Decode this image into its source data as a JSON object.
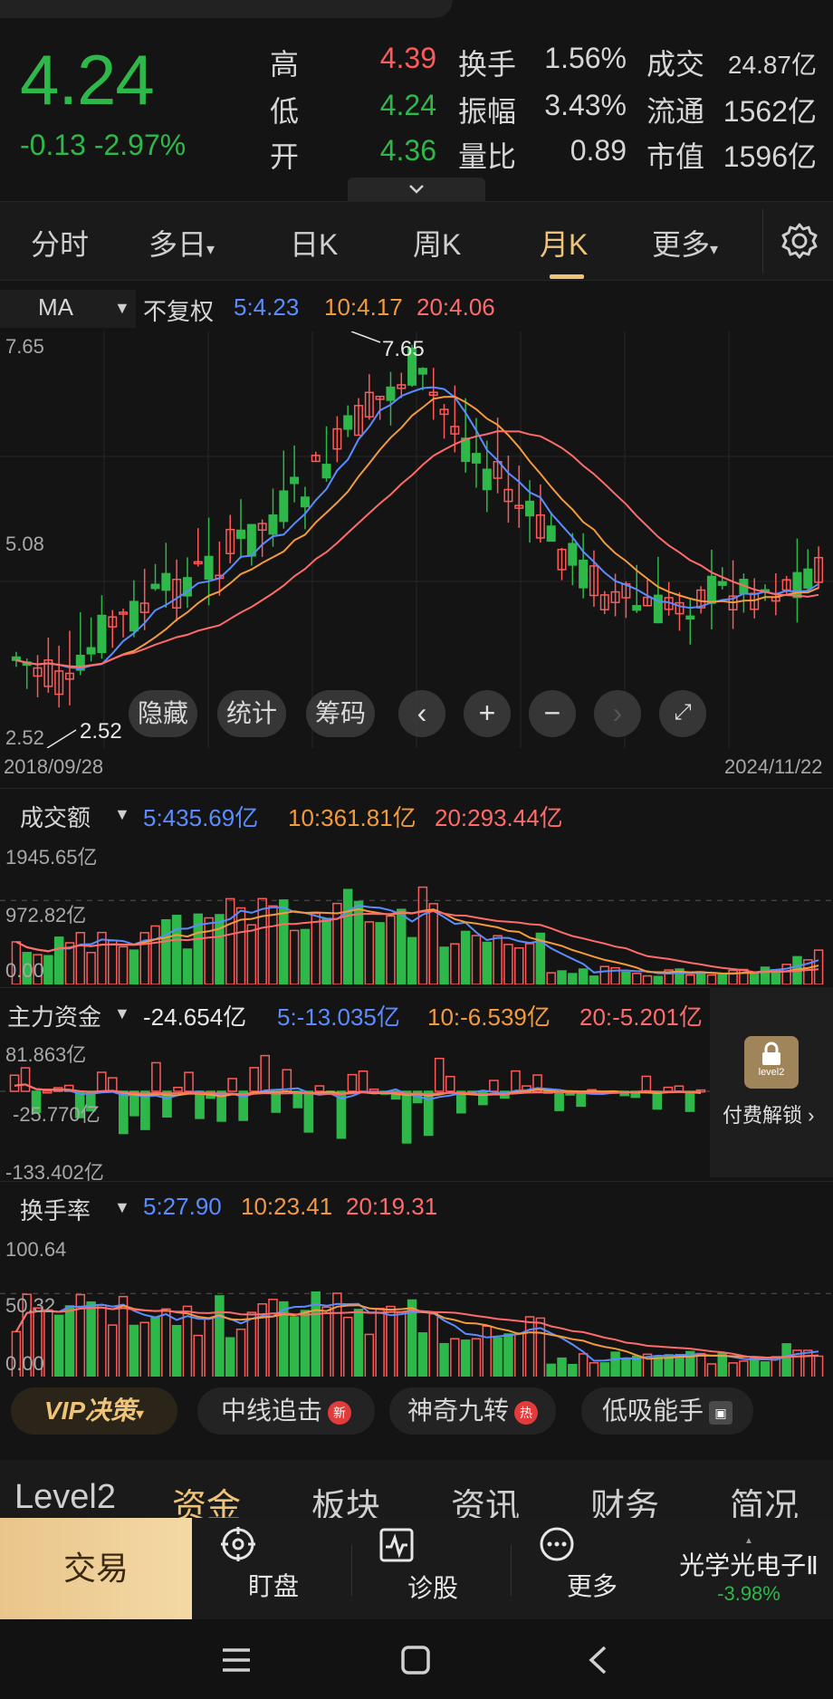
{
  "quote": {
    "price": "4.24",
    "change": "-0.13 -2.97%",
    "stats": [
      {
        "label": "高",
        "value": "4.39",
        "color": "red"
      },
      {
        "label": "换手",
        "value": "1.56%",
        "color": "white"
      },
      {
        "label": "成交",
        "value": "24.87亿",
        "color": "white"
      },
      {
        "label": "低",
        "value": "4.24",
        "color": "green"
      },
      {
        "label": "振幅",
        "value": "3.43%",
        "color": "white"
      },
      {
        "label": "流通",
        "value": "1562亿",
        "color": "white"
      },
      {
        "label": "开",
        "value": "4.36",
        "color": "green"
      },
      {
        "label": "量比",
        "value": "0.89",
        "color": "white"
      },
      {
        "label": "市值",
        "value": "1596亿",
        "color": "white"
      }
    ],
    "expand_icon": "chevron-down-icon"
  },
  "tabs": [
    {
      "label": "分时"
    },
    {
      "label": "多日"
    },
    {
      "label": "日K"
    },
    {
      "label": "周K"
    },
    {
      "label": "月K",
      "active": true
    },
    {
      "label": "更多"
    }
  ],
  "settings_icon": "gear-icon",
  "kline": {
    "indicator": "MA",
    "adjust": "不复权",
    "ma5": "5:4.23",
    "ma10": "10:4.17",
    "ma20": "20:4.06",
    "y_top": "7.65",
    "y_mid": "5.08",
    "y_bottom": "2.52",
    "high_marker": "7.65",
    "low_marker": "2.52",
    "date_start": "2018/09/28",
    "date_end": "2024/11/22",
    "tools": [
      "隐藏",
      "统计",
      "筹码"
    ]
  },
  "volume": {
    "title": "成交额",
    "ma5": "5:435.69亿",
    "ma10": "10:361.81亿",
    "ma20": "20:293.44亿",
    "y_top": "1945.65亿",
    "y_mid": "972.82亿",
    "y_bottom": "0.00"
  },
  "capital": {
    "title": "主力资金",
    "value": "-24.654亿",
    "ma5": "5:-13.035亿",
    "ma10": "10:-6.539亿",
    "ma20": "20:-5.201亿",
    "y_top": "81.863亿",
    "y_mid": "-25.770亿",
    "y_bottom": "-133.402亿",
    "lock_label": "level2",
    "unlock_text": "付费解锁 ›"
  },
  "turnover": {
    "title": "换手率",
    "ma5": "5:27.90",
    "ma10": "10:23.41",
    "ma20": "20:19.31",
    "y_top": "100.64",
    "y_mid": "50.32",
    "y_bottom": "0.00"
  },
  "chips": {
    "vip": "VIP决策",
    "items": [
      {
        "label": "中线追击",
        "badge": "新"
      },
      {
        "label": "神奇九转",
        "badge": "热"
      },
      {
        "label": "低吸能手",
        "badge": "▣"
      }
    ]
  },
  "categories": [
    "Level2",
    "资金",
    "板块",
    "资讯",
    "财务",
    "简况"
  ],
  "action_bar": {
    "trade": "交易",
    "items": [
      {
        "label": "盯盘",
        "icon": "target-icon"
      },
      {
        "label": "诊股",
        "icon": "pulse-icon"
      },
      {
        "label": "更多",
        "icon": "more-dots-icon"
      }
    ],
    "sector_name": "光学光电子Ⅱ",
    "sector_change": "-3.98%"
  },
  "colors": {
    "up": "#ff5a5a",
    "down": "#2fb84a",
    "ma5": "#5b8cff",
    "ma10": "#f39a3d",
    "ma20": "#ff6b6b",
    "gold": "#f0c477"
  }
}
